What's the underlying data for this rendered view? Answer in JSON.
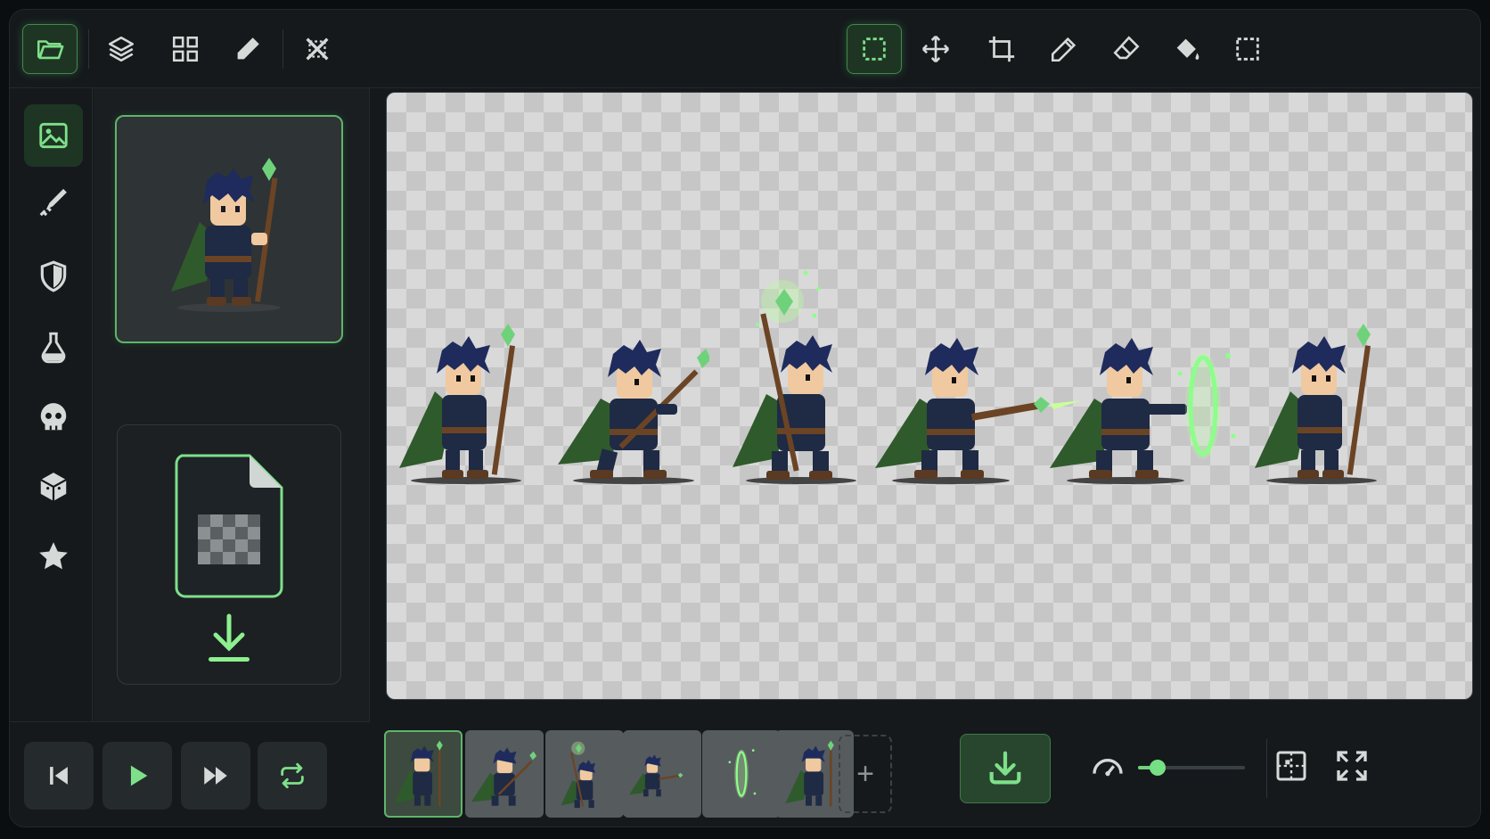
{
  "colors": {
    "accent": "#6fd27b",
    "accent_glow": "#8cff8a",
    "panel": "#15191c",
    "canvas_checker_light": "#d9d9d9",
    "canvas_checker_dark": "#c6c6c6",
    "robe": "#1f2a44",
    "cape": "#2f5a2c",
    "hair": "#1e2b5c",
    "staff": "#6b4425"
  },
  "toolbar": {
    "left_tools": [
      {
        "icon": "folder-open-icon",
        "active": true
      },
      {
        "icon": "layers-icon",
        "active": false
      },
      {
        "icon": "grid-icon",
        "active": false
      },
      {
        "icon": "pen-icon",
        "active": false
      },
      {
        "icon": "sprite-tool-icon",
        "active": false
      }
    ],
    "right_tools": [
      {
        "icon": "marquee-select-icon",
        "active": true
      },
      {
        "icon": "move-icon",
        "active": false
      },
      {
        "icon": "crop-icon",
        "active": false
      },
      {
        "icon": "pencil-icon",
        "active": false
      },
      {
        "icon": "eraser-icon",
        "active": false
      },
      {
        "icon": "paint-bucket-icon",
        "active": false
      },
      {
        "icon": "dashed-selection-icon",
        "active": false
      }
    ]
  },
  "rail": {
    "items": [
      {
        "icon": "image-icon",
        "active": true
      },
      {
        "icon": "sword-icon",
        "active": false
      },
      {
        "icon": "shield-icon",
        "active": false
      },
      {
        "icon": "potion-icon",
        "active": false
      },
      {
        "icon": "skull-icon",
        "active": false
      },
      {
        "icon": "cube-icon",
        "active": false
      },
      {
        "icon": "star-icon",
        "active": false
      }
    ]
  },
  "asset_panel": {
    "preview_icon": "mage-character-sprite",
    "import_icon": "transparent-file-icon",
    "download_icon": "download-arrow-icon"
  },
  "canvas": {
    "frames": [
      {
        "pose": "idle"
      },
      {
        "pose": "step-forward"
      },
      {
        "pose": "raise-staff"
      },
      {
        "pose": "cast-bolt"
      },
      {
        "pose": "cast-portal"
      },
      {
        "pose": "idle"
      }
    ]
  },
  "playback": {
    "buttons": [
      {
        "icon": "skip-back-icon"
      },
      {
        "icon": "play-icon"
      },
      {
        "icon": "fast-forward-icon"
      },
      {
        "icon": "loop-icon"
      }
    ]
  },
  "timeline": {
    "add_label": "+",
    "speed_level": 0.18
  }
}
